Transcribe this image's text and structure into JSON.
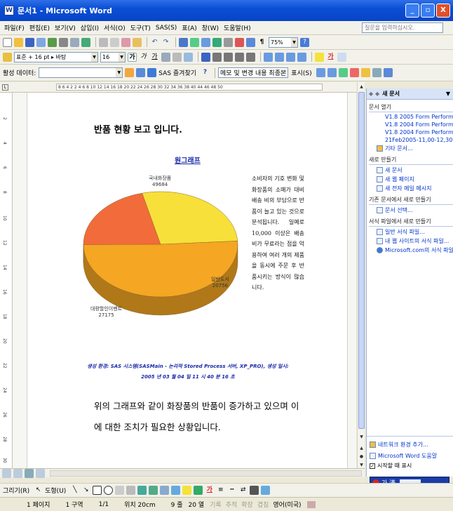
{
  "window": {
    "title": "문서1 - Microsoft Word",
    "app_icon": "W",
    "min": "_",
    "max": "▫",
    "close": "X"
  },
  "menu": {
    "items": [
      "파일(F)",
      "편집(E)",
      "보기(V)",
      "삽입(I)",
      "서식(O)",
      "도구(T)",
      "SAS(S)",
      "표(A)",
      "창(W)",
      "도움말(H)"
    ],
    "question_placeholder": "질문을 입력하십시오."
  },
  "toolbar": {
    "zoom": "75%",
    "style": "표준 + 16 pt ▸ 바탕",
    "font_size": "16",
    "bold": "가",
    "italic": "가",
    "underline": "가",
    "reviewing_label": "활성 데이터:",
    "sas_favorites": "SAS 즐겨찾기",
    "markup": "메모 및 변경 내용 최종본",
    "show": "표시(S)"
  },
  "ruler": {
    "ticks": "8 6 4 2 2 4 6 8 10 12 14 16 18 20 22 24 26 28 30 32 34 36 38 40 44 46 48 50"
  },
  "vruler": {
    "ticks": [
      "2",
      "4",
      "6",
      "8",
      "10",
      "12",
      "14",
      "16",
      "18",
      "20",
      "22",
      "24",
      "26",
      "28",
      "30"
    ]
  },
  "document": {
    "line1": "반품 현황 보고 입니다.",
    "chart_title": "원그래프",
    "side_text": "소비자의 기호 변화 및 화장품의 소매가 대비 배송 비의 부담으로 반품이 늘고 있는 것으로 분석됩니다. 일예로 10,000 이상은 배송비가 무료라는 점을 악용하여 여러 개의 제품을 동시에 주문 후 반품시키는 방식이 많습니다.",
    "caption1": "생성 환경: SAS 시스템(SASMain - 논리적 Stored Process 서버, XP_PRO), 생성 일시:",
    "caption2": "2005 년 03 월 04 일 11 시 40 분 16 초",
    "line2": "위의 그래프와 같이 화장품의 반품이 증가하고 있으며 이",
    "line3": "에 대한 조치가 필요한 상황입니다."
  },
  "chart_data": {
    "type": "pie",
    "title": "원그래프",
    "categories": [
      "국내화장품",
      "일반도서",
      "대량할인이벤트"
    ],
    "values": [
      49684,
      20756,
      27175
    ],
    "colors": [
      "#f5a623",
      "#f26b3a",
      "#f7e03a"
    ]
  },
  "taskpane": {
    "title": "새 문서",
    "sec_open": "문서 열기",
    "recent": [
      "V1.8 2005 Form Performanc",
      "V1.8 2004 Form Performanc",
      "V1.8 2004 Form Performanc",
      "21Feb2005-11,00-12,30.doc"
    ],
    "more_docs": "기타 문서...",
    "sec_new": "새로 만들기",
    "new_items": [
      "새 문서",
      "새 웹 페이지",
      "새 전자 메일 메시지"
    ],
    "sec_existing": "기존 문서에서 새로 만들기",
    "choose_doc": "문서 선택...",
    "sec_template": "서식 파일에서 새로 만들기",
    "template_items": [
      "일반 서식 파일...",
      "내 웹 사이트의 서식 파일...",
      "Microsoft.com의 서식 파일"
    ],
    "network": "네트워크 환경 추가...",
    "help": "Microsoft Word 도움말",
    "startup": "시작할 때 표시"
  },
  "draw": {
    "draw_label": "그리기(R)",
    "shapes_label": "도형(U)"
  },
  "status": {
    "page": "1 페이지",
    "section": "1 구역",
    "pages": "1/1",
    "pos": "위치 20cm",
    "line": "9 줄",
    "col": "20 열",
    "rec": "기록",
    "trk": "추적",
    "ext": "확장",
    "ovr": "겹침",
    "lang": "영어(미국)"
  },
  "ime": {
    "label": "가 漢"
  }
}
